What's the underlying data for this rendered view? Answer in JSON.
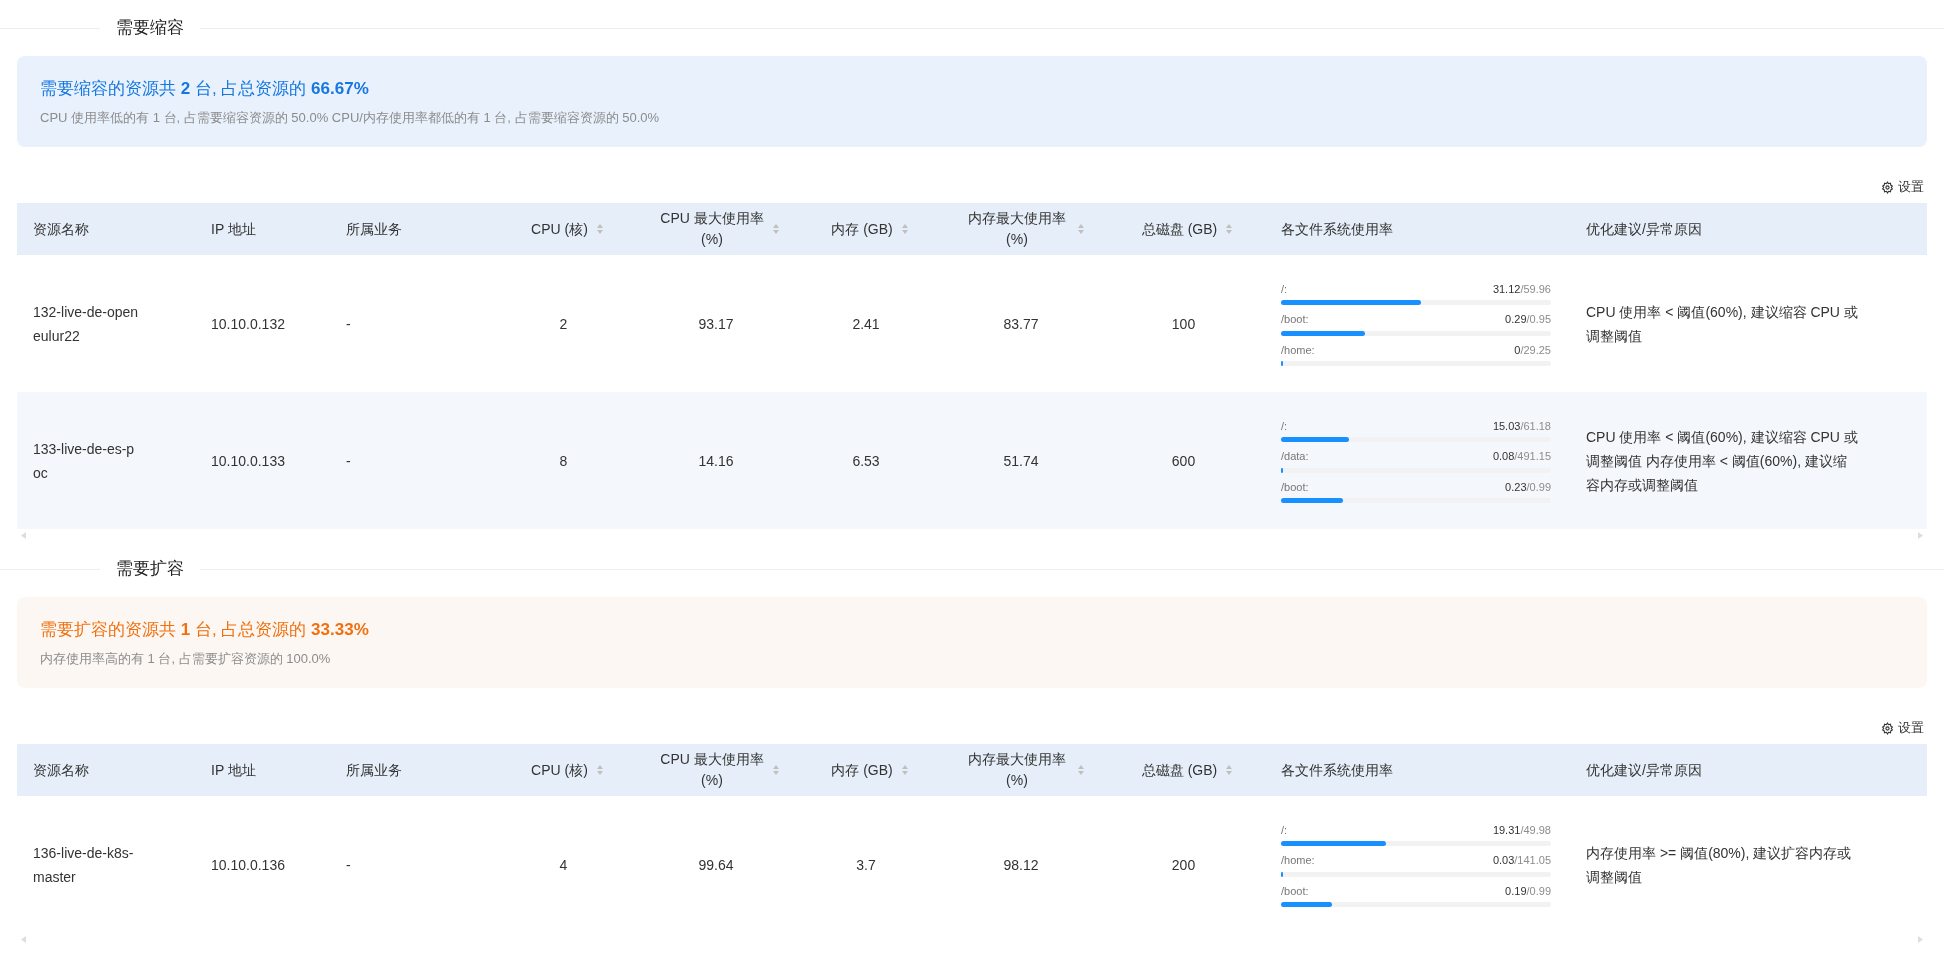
{
  "sections": [
    {
      "title": "需要缩容",
      "banner": {
        "kind": "shrink",
        "headline": "需要缩容的资源共 **2** 台, 占总资源的 **66.67%**",
        "detail": "CPU 使用率低的有 1 台, 占需要缩容资源的 50.0% CPU/内存使用率都低的有 1 台, 占需要缩容资源的 50.0%"
      },
      "settings": "设置",
      "table": {
        "columns": [
          {
            "label": "资源名称",
            "sortable": false
          },
          {
            "label": "IP 地址",
            "sortable": false
          },
          {
            "label": "所属业务",
            "sortable": false
          },
          {
            "label": "CPU (核)",
            "sortable": true
          },
          {
            "label": "CPU 最大使用率 (%)",
            "sortable": true
          },
          {
            "label": "内存 (GB)",
            "sortable": true
          },
          {
            "label": "内存最大使用率 (%)",
            "sortable": true
          },
          {
            "label": "总磁盘 (GB)",
            "sortable": true
          },
          {
            "label": "各文件系统使用率",
            "sortable": false
          },
          {
            "label": "优化建议/异常原因",
            "sortable": false
          }
        ],
        "rows": [
          {
            "name": "132-live-de-openeulur22",
            "ip": "10.10.0.132",
            "business": "-",
            "cpu": "2",
            "cpu_max": "93.17",
            "mem": "2.41",
            "mem_max": "83.77",
            "disk": "100",
            "filesystems": [
              {
                "path": "/:",
                "used": "31.12",
                "total": "/59.96",
                "level": 0.52
              },
              {
                "path": "/boot:",
                "used": "0.29",
                "total": "/0.95",
                "level": 0.31
              },
              {
                "path": "/home:",
                "used": "0",
                "total": "/29.25",
                "level": 0
              }
            ],
            "advice": "CPU 使用率 < 阈值(60%), 建议缩容 CPU 或调整阈值"
          },
          {
            "name": "133-live-de-es-poc",
            "ip": "10.10.0.133",
            "business": "-",
            "cpu": "8",
            "cpu_max": "14.16",
            "mem": "6.53",
            "mem_max": "51.74",
            "disk": "600",
            "filesystems": [
              {
                "path": "/:",
                "used": "15.03",
                "total": "/61.18",
                "level": 0.25
              },
              {
                "path": "/data:",
                "used": "0.08",
                "total": "/491.15",
                "level": 0
              },
              {
                "path": "/boot:",
                "used": "0.23",
                "total": "/0.99",
                "level": 0.23
              }
            ],
            "advice": "CPU 使用率 < 阈值(60%), 建议缩容 CPU 或调整阈值 内存使用率 < 阈值(60%), 建议缩容内存或调整阈值"
          }
        ]
      }
    },
    {
      "title": "需要扩容",
      "banner": {
        "kind": "expand",
        "headline": "需要扩容的资源共 **1** 台, 占总资源的 **33.33%**",
        "detail": "内存使用率高的有 1 台, 占需要扩容资源的 100.0%"
      },
      "settings": "设置",
      "table": {
        "columns": [
          {
            "label": "资源名称",
            "sortable": false
          },
          {
            "label": "IP 地址",
            "sortable": false
          },
          {
            "label": "所属业务",
            "sortable": false
          },
          {
            "label": "CPU (核)",
            "sortable": true
          },
          {
            "label": "CPU 最大使用率 (%)",
            "sortable": true
          },
          {
            "label": "内存 (GB)",
            "sortable": true
          },
          {
            "label": "内存最大使用率 (%)",
            "sortable": true
          },
          {
            "label": "总磁盘 (GB)",
            "sortable": true
          },
          {
            "label": "各文件系统使用率",
            "sortable": false
          },
          {
            "label": "优化建议/异常原因",
            "sortable": false
          }
        ],
        "rows": [
          {
            "name": "136-live-de-k8s-master",
            "ip": "10.10.0.136",
            "business": "-",
            "cpu": "4",
            "cpu_max": "99.64",
            "mem": "3.7",
            "mem_max": "98.12",
            "disk": "200",
            "filesystems": [
              {
                "path": "/:",
                "used": "19.31",
                "total": "/49.98",
                "level": 0.39
              },
              {
                "path": "/home:",
                "used": "0.03",
                "total": "/141.05",
                "level": 0
              },
              {
                "path": "/boot:",
                "used": "0.19",
                "total": "/0.99",
                "level": 0.19
              }
            ],
            "advice": "内存使用率 >= 阈值(80%), 建议扩容内存或调整阈值"
          }
        ]
      }
    }
  ]
}
